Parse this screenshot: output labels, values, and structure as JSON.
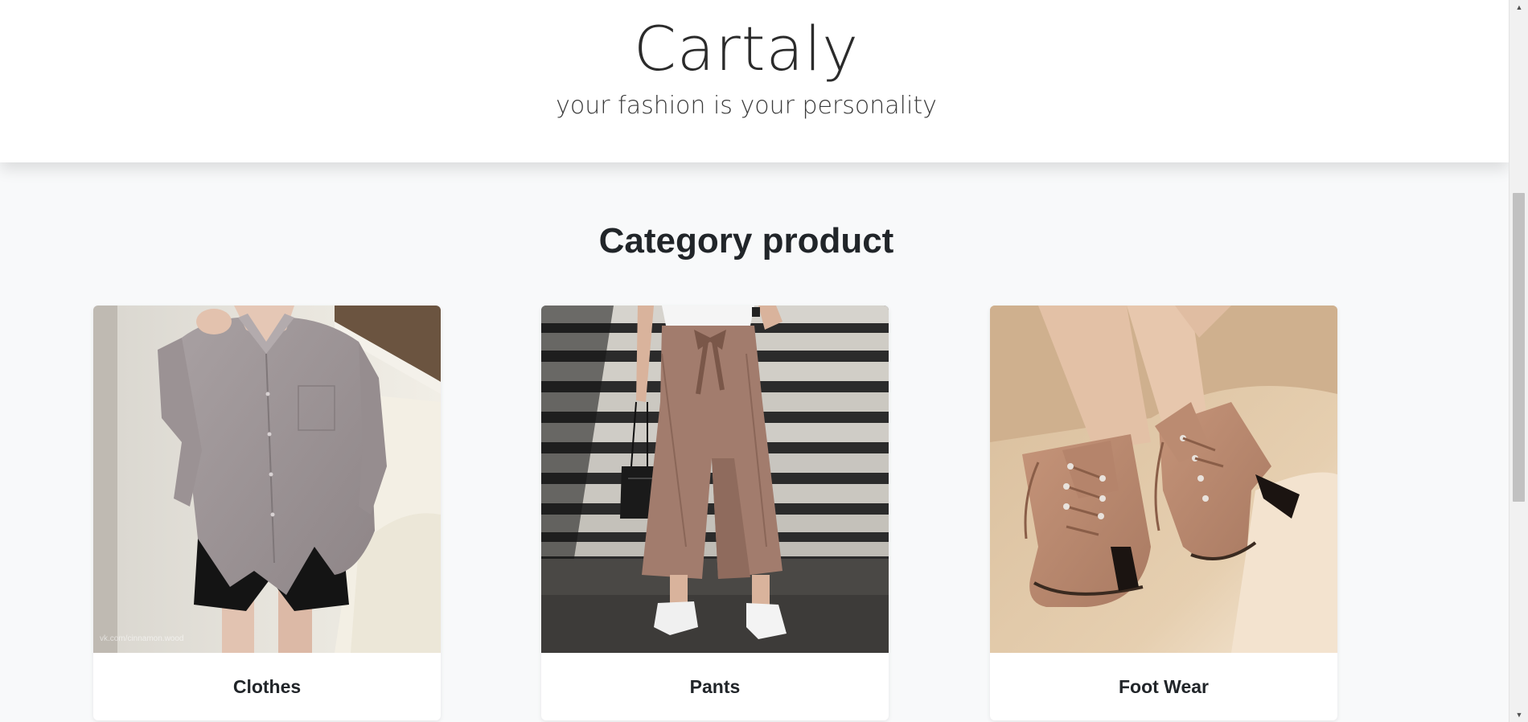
{
  "header": {
    "brand": "Cartaly",
    "tagline": "your fashion is your personality"
  },
  "section": {
    "title": "Category product"
  },
  "categories": [
    {
      "label": "Clothes",
      "image_icon": "shirt-photo",
      "watermark": "vk.com/cinnamon.wood"
    },
    {
      "label": "Pants",
      "image_icon": "pants-photo"
    },
    {
      "label": "Foot Wear",
      "image_icon": "boots-photo"
    }
  ],
  "scrollbar": {
    "up_arrow": "▲",
    "down_arrow": "▼"
  },
  "colors": {
    "page_bg": "#f8f9fa",
    "header_bg": "#ffffff",
    "text": "#212529"
  }
}
